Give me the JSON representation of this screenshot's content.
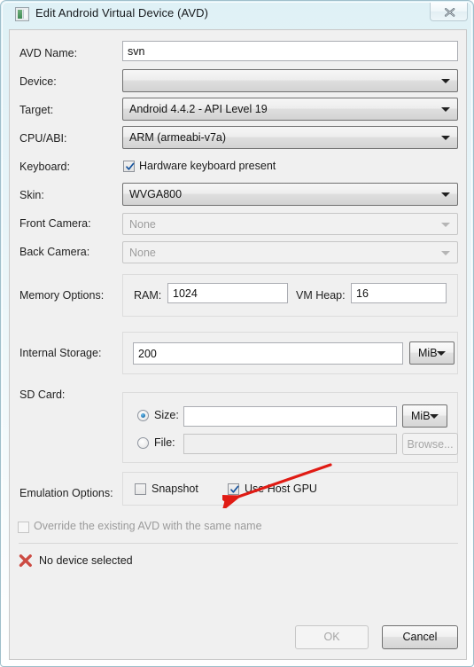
{
  "window": {
    "title": "Edit Android Virtual Device (AVD)",
    "icon": "avd-window-icon",
    "close_label": "Close"
  },
  "form": {
    "avd_name": {
      "label": "AVD Name:",
      "value": "svn",
      "placeholder": ""
    },
    "device": {
      "label": "Device:",
      "value": "",
      "placeholder": ""
    },
    "target": {
      "label": "Target:",
      "value": "Android 4.4.2 - API Level 19"
    },
    "cpu_abi": {
      "label": "CPU/ABI:",
      "value": "ARM (armeabi-v7a)"
    },
    "keyboard": {
      "label": "Keyboard:",
      "checkbox_label": "Hardware keyboard present",
      "checked": true
    },
    "skin": {
      "label": "Skin:",
      "value": "WVGA800"
    },
    "front_camera": {
      "label": "Front Camera:",
      "value": "None",
      "disabled": true
    },
    "back_camera": {
      "label": "Back Camera:",
      "value": "None",
      "disabled": true
    },
    "memory_options": {
      "label": "Memory Options:",
      "ram_label": "RAM:",
      "ram_value": "1024",
      "vmheap_label": "VM Heap:",
      "vmheap_value": "16"
    },
    "internal_storage": {
      "label": "Internal Storage:",
      "value": "200",
      "unit": "MiB"
    },
    "sd_card": {
      "label": "SD Card:",
      "size_radio_label": "Size:",
      "size_selected": true,
      "size_value": "",
      "size_unit": "MiB",
      "file_radio_label": "File:",
      "file_selected": false,
      "file_value": "",
      "browse_label": "Browse..."
    },
    "emulation_options": {
      "label": "Emulation Options:",
      "snapshot_label": "Snapshot",
      "snapshot_checked": false,
      "host_gpu_label": "Use Host GPU",
      "host_gpu_checked": true
    },
    "override": {
      "label": "Override the existing AVD with the same name",
      "checked": false,
      "disabled": true
    }
  },
  "status": {
    "icon": "error-x-icon",
    "message": "No device selected"
  },
  "footer": {
    "ok_label": "OK",
    "ok_disabled": true,
    "cancel_label": "Cancel"
  },
  "annotation": {
    "type": "red-arrow",
    "color": "#e01b14",
    "points_to": "Use Host GPU"
  },
  "colors": {
    "accent": "#1a6ba8",
    "error": "#d9534f",
    "annotation": "#e01b14",
    "dialog_bg": "#f0f0f0",
    "frame": "#9fbfcb"
  }
}
